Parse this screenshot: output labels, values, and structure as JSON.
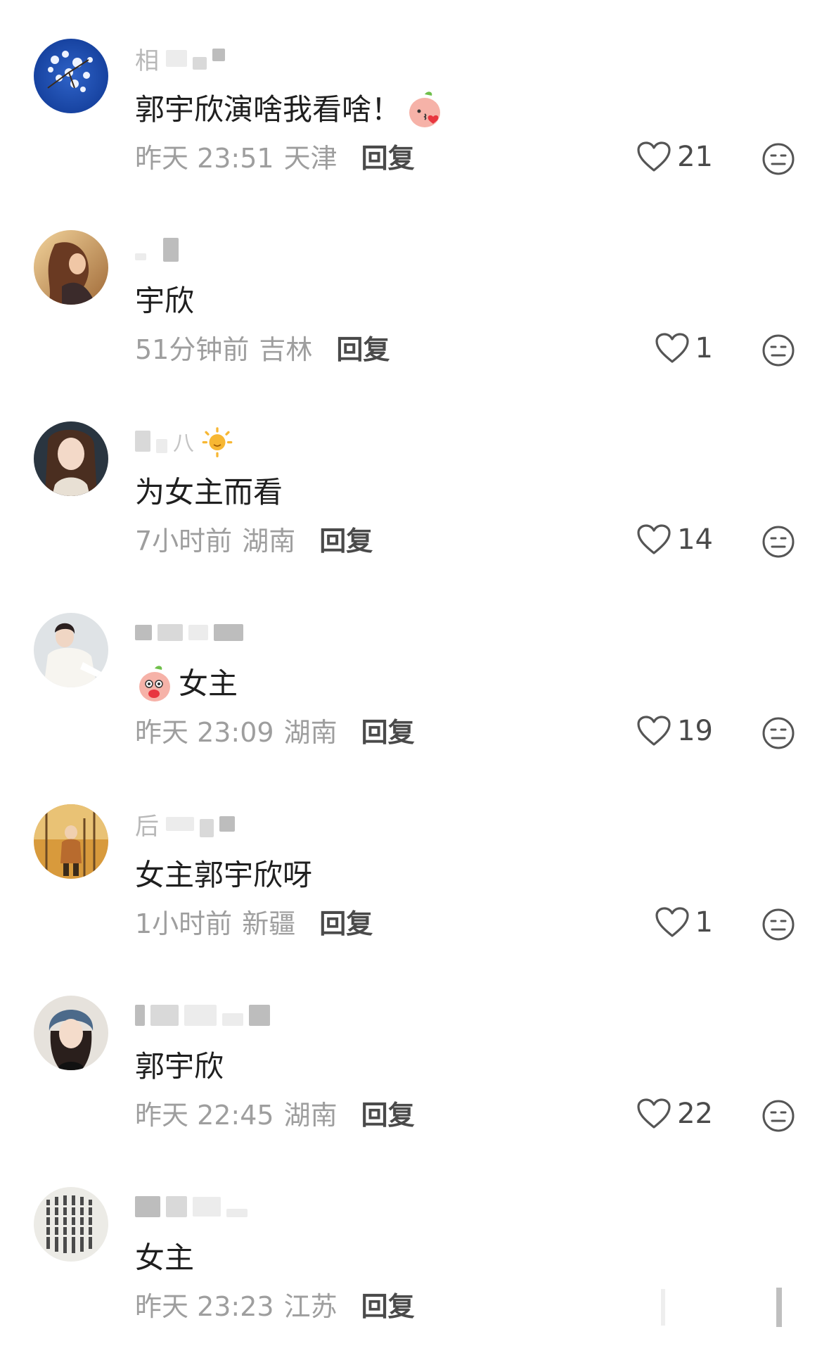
{
  "comments": [
    {
      "username_prefix": "相",
      "text": "郭宇欣演啥我看啥！",
      "time": "昨天 23:51",
      "location": "天津",
      "reply_label": "回复",
      "likes": "21",
      "avatar_icon": "blue-flower-avatar",
      "trailing_emoji": "kiss-peach-emoji"
    },
    {
      "username_prefix": "",
      "text": "宇欣",
      "time": "51分钟前",
      "location": "吉林",
      "reply_label": "回复",
      "likes": "1",
      "avatar_icon": "woman-wind-hair-avatar"
    },
    {
      "username_prefix": "",
      "text": "为女主而看",
      "time": "7小时前",
      "location": "湖南",
      "reply_label": "回复",
      "likes": "14",
      "avatar_icon": "woman-portrait-avatar",
      "name_emoji": "sun-emoji"
    },
    {
      "username_prefix": "",
      "text": "女主",
      "time": "昨天 23:09",
      "location": "湖南",
      "reply_label": "回复",
      "likes": "19",
      "avatar_icon": "woman-white-dress-avatar",
      "leading_emoji": "shy-peach-emoji"
    },
    {
      "username_prefix": "后",
      "text": "女主郭宇欣呀",
      "time": "1小时前",
      "location": "新疆",
      "reply_label": "回复",
      "likes": "1",
      "avatar_icon": "autumn-trees-avatar"
    },
    {
      "username_prefix": "",
      "text": "郭宇欣",
      "time": "昨天 22:45",
      "location": "湖南",
      "reply_label": "回复",
      "likes": "22",
      "avatar_icon": "woman-headscarf-avatar"
    },
    {
      "username_prefix": "",
      "text": "女主",
      "time": "昨天 23:23",
      "location": "江苏",
      "reply_label": "回复",
      "likes": "",
      "avatar_icon": "calligraphy-avatar"
    }
  ]
}
